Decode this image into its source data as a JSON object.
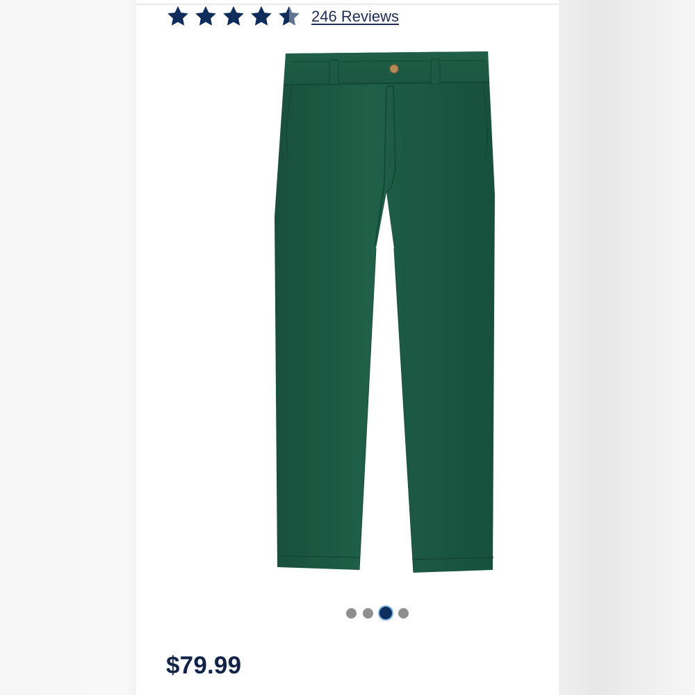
{
  "app": {
    "title": ""
  },
  "product": {
    "rating": {
      "stars_value": 4.5,
      "stars_max": 5,
      "reviews_label": "246 Reviews",
      "star_color": "#0f2d5a"
    },
    "image": {
      "subject": "green chino pants",
      "color": "#1f5e47"
    },
    "carousel": {
      "count": 4,
      "active_index": 2,
      "active_color": "#0d2f60",
      "inactive_color": "#8f8f8f"
    },
    "price": "$79.99"
  },
  "icons": {
    "star": "star-icon",
    "half_star": "half-star-icon"
  }
}
